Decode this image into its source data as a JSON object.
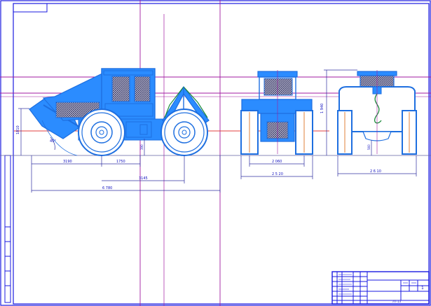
{
  "drawing": {
    "dimensions": {
      "side_height": "1810",
      "blade_angle": "45°",
      "blade_to_front_axle": "3190",
      "front_overhang": "1750",
      "wheelbase": "3145",
      "overall_length": "6 780",
      "ground_clearance": "390",
      "front_track": "2 060",
      "front_total_width": "2 5 20",
      "rear_total_height": "1 940",
      "rear_clearance": "560",
      "rear_total_width": "2 6 10"
    },
    "title_block": {
      "sheet_label": "1",
      "stamp_note": "ЛТ-13"
    }
  },
  "colors": {
    "frame": "#1a1ae0",
    "outline": "#1e6fe0",
    "fill": "#2b8cff",
    "dimension": "#3030a0",
    "axis_magenta": "#a01aa0",
    "axis_red": "#e04040",
    "hatch": "#303060",
    "green": "#1a8a3a"
  }
}
